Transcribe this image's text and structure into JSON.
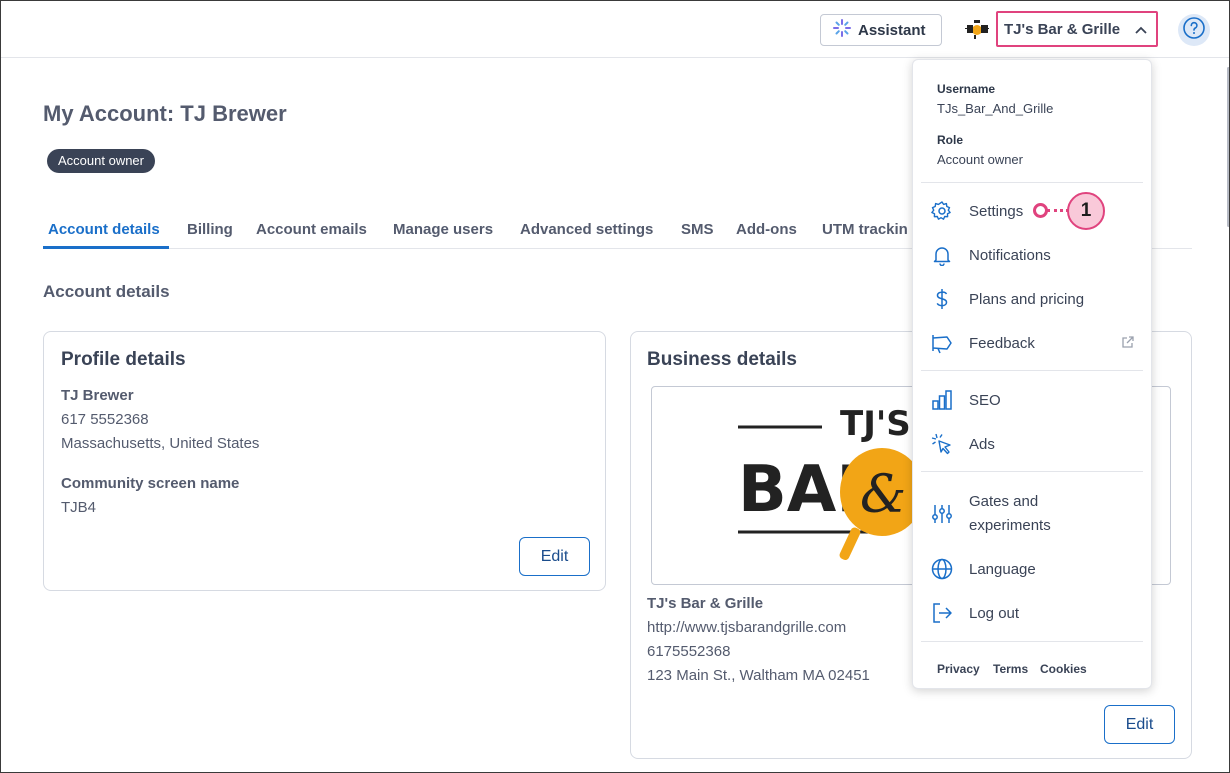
{
  "topbar": {
    "assistant_label": "Assistant",
    "account_name": "TJ's Bar & Grille"
  },
  "page": {
    "title": "My Account: TJ Brewer",
    "badge": "Account owner",
    "section_title": "Account details"
  },
  "tabs": [
    {
      "label": "Account details"
    },
    {
      "label": "Billing"
    },
    {
      "label": "Account emails"
    },
    {
      "label": "Manage users"
    },
    {
      "label": "Advanced settings"
    },
    {
      "label": "SMS"
    },
    {
      "label": "Add-ons"
    },
    {
      "label": "UTM trackin"
    }
  ],
  "profile": {
    "title": "Profile details",
    "name": "TJ Brewer",
    "phone": "617 5552368",
    "location": "Massachusetts, United States",
    "screen_name_label": "Community screen name",
    "screen_name": "TJB4",
    "edit_label": "Edit"
  },
  "business": {
    "title": "Business details",
    "logo_text_top": "TJ'S",
    "logo_text_main": "BAR",
    "logo_text_amp": "&",
    "name": "TJ's Bar & Grille",
    "url": "http://www.tjsbarandgrille.com",
    "phone": "6175552368",
    "address": "123 Main St., Waltham MA 02451",
    "edit_label": "Edit"
  },
  "dropdown": {
    "username_label": "Username",
    "username": "TJs_Bar_And_Grille",
    "role_label": "Role",
    "role": "Account owner",
    "items": [
      {
        "label": "Settings"
      },
      {
        "label": "Notifications"
      },
      {
        "label": "Plans and pricing"
      },
      {
        "label": "Feedback"
      },
      {
        "label": "SEO"
      },
      {
        "label": "Ads"
      },
      {
        "label": "Gates and"
      },
      {
        "label": "Language"
      },
      {
        "label": "Log out"
      }
    ],
    "gates_line2": "experiments",
    "footer": {
      "privacy": "Privacy",
      "terms": "Terms",
      "cookies": "Cookies"
    }
  },
  "callout": {
    "number": "1"
  },
  "colors": {
    "accent": "#1a6fc9",
    "highlight": "#e0437e",
    "badge_bg": "#3a4356",
    "logo_orange": "#f2a516"
  }
}
